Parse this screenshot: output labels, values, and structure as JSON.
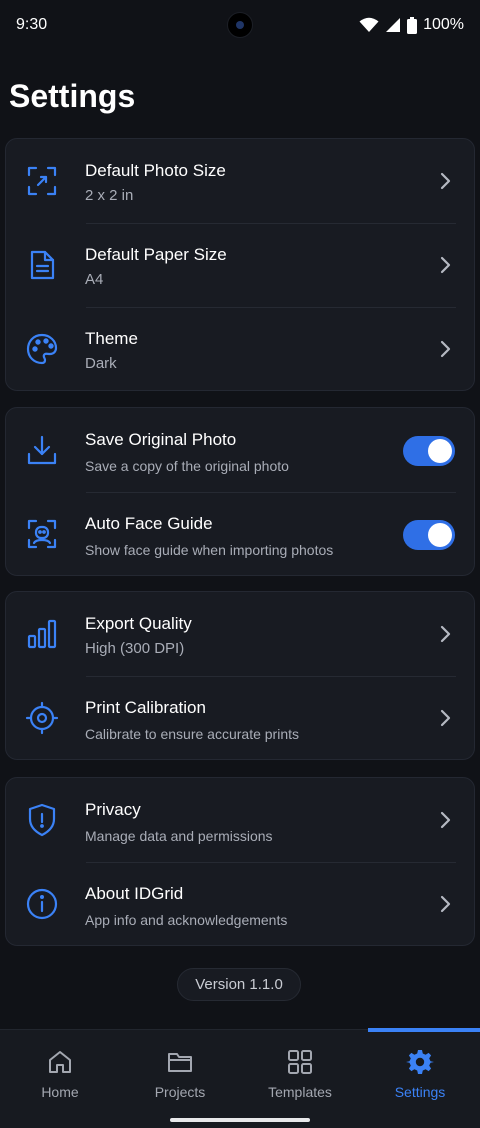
{
  "status_bar": {
    "time": "9:30",
    "battery": "100%"
  },
  "title": "Settings",
  "groups": [
    {
      "items": [
        {
          "icon": "photo-size-icon",
          "title": "Default Photo Size",
          "subtitle": "2 x 2 in",
          "control": "chevron"
        },
        {
          "icon": "document-icon",
          "title": "Default Paper Size",
          "subtitle": "A4",
          "control": "chevron"
        },
        {
          "icon": "palette-icon",
          "title": "Theme",
          "subtitle": "Dark",
          "control": "chevron"
        }
      ]
    },
    {
      "items": [
        {
          "icon": "download-icon",
          "title": "Save Original Photo",
          "subtitle": "Save a copy of the original photo",
          "control": "toggle",
          "on": true
        },
        {
          "icon": "face-scan-icon",
          "title": "Auto Face Guide",
          "subtitle": "Show face guide when importing photos",
          "control": "toggle",
          "on": true
        }
      ]
    },
    {
      "items": [
        {
          "icon": "bar-chart-icon",
          "title": "Export Quality",
          "subtitle": "High (300 DPI)",
          "control": "chevron"
        },
        {
          "icon": "crosshair-icon",
          "title": "Print Calibration",
          "subtitle": "Calibrate to ensure accurate prints",
          "control": "chevron"
        }
      ]
    },
    {
      "items": [
        {
          "icon": "shield-icon",
          "title": "Privacy",
          "subtitle": "Manage data and permissions",
          "control": "chevron"
        },
        {
          "icon": "info-icon",
          "title": "About IDGrid",
          "subtitle": "App info and acknowledgements",
          "control": "chevron"
        }
      ]
    }
  ],
  "version": "Version 1.1.0",
  "nav": [
    {
      "label": "Home",
      "icon": "home-icon",
      "active": false
    },
    {
      "label": "Projects",
      "icon": "folder-icon",
      "active": false
    },
    {
      "label": "Templates",
      "icon": "grid-icon",
      "active": false
    },
    {
      "label": "Settings",
      "icon": "gear-icon",
      "active": true
    }
  ],
  "colors": {
    "accent": "#3b82f6",
    "background": "#101217",
    "card": "#181b22",
    "toggle_on": "#2f6fe6"
  }
}
